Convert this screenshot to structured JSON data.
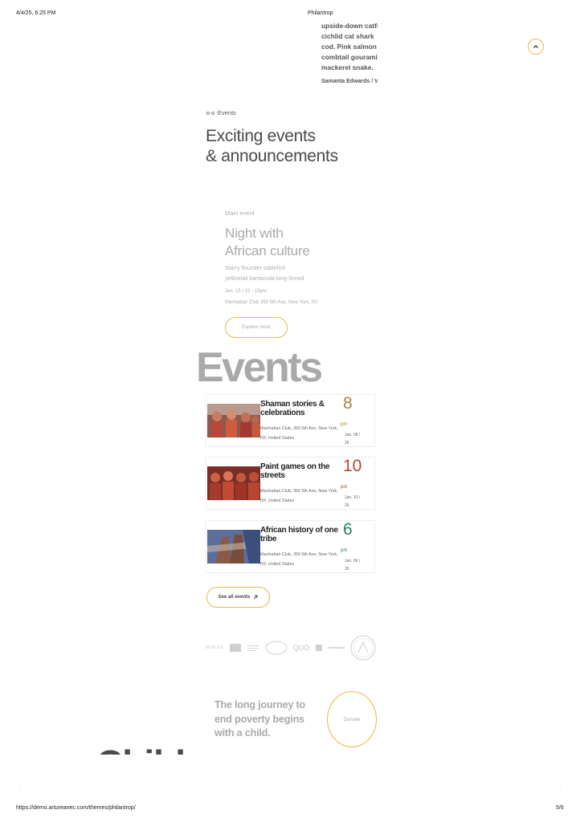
{
  "print": {
    "date": "4/4/25, 6:25 PM",
    "title": "Philantrop",
    "url": "https://demo.artureanec.com/themes/philantrop/",
    "page": "5/6"
  },
  "testimonial": {
    "lines": [
      "upside-down catfish",
      "cichlid cat shark",
      "cod. Pink salmon",
      "combtail gourami",
      "mackerel snake."
    ],
    "author": "Samanta Edwards / Volunteer"
  },
  "scroll_top": {
    "icon": "chevron-up-icon"
  },
  "events_section": {
    "label": "Events",
    "heading_line1": "Exciting events",
    "heading_line2": "& announcements"
  },
  "main_event": {
    "label": "Main event",
    "title_line1": "Night with",
    "title_line2": "African culture",
    "desc_line1": "Starry flounder sablefish",
    "desc_line2": "yellowtail barracuda long-finned",
    "datetime": "Jan. 15 / 22 - 10pm",
    "location": "Manhattan Club 350 5th Ave, New York, NY",
    "button": "Explore more"
  },
  "big_title": "Events",
  "events": [
    {
      "title": "Shaman stories & celebrations",
      "address": "Manhattan Club, 350 5th Ave, New York, NY, United States",
      "day": "8",
      "ampm": "pm",
      "date": "Jan. 08 / 26",
      "accent": "#a8843a"
    },
    {
      "title": "Paint games on the streets",
      "address": "Manhattan Club, 350 5th Ave, New York, NY, United States",
      "day": "10",
      "ampm": "pm",
      "date": "Jan. 10 / 26",
      "accent": "#b0472f"
    },
    {
      "title": "African history of one tribe",
      "address": "Manhattan Club, 350 5th Ave, New York, NY, United States",
      "day": "6",
      "ampm": "pm",
      "date": "Jan. 06 / 26",
      "accent": "#2b7d66"
    }
  ],
  "see_all": {
    "label": "See all events",
    "icon": "arrow-up-right-icon"
  },
  "sponsors": [
    "MINIZE",
    "QUO"
  ],
  "donate": {
    "line1": "The long journey to",
    "line2": "end poverty begins",
    "line3": "with a child.",
    "button": "Donate"
  },
  "cropped_heading": "Child"
}
